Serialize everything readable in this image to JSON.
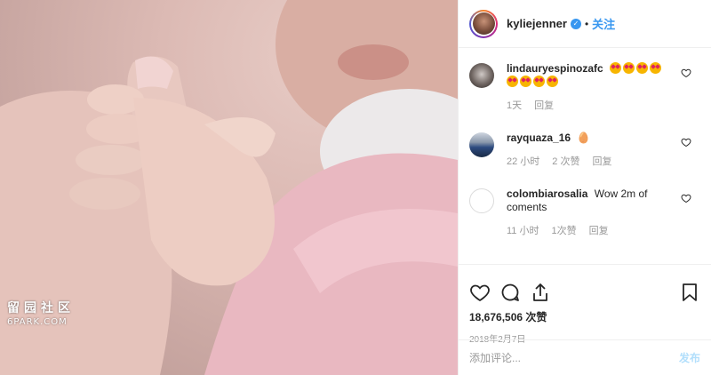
{
  "post": {
    "photo_alt": "baby hand holding finger photo",
    "watermark": {
      "cn": "留园社区",
      "en": "6PARK.COM"
    }
  },
  "header": {
    "username": "kyliejenner",
    "verified_icon": "verified-badge-icon",
    "separator": "•",
    "follow_label": "关注"
  },
  "comments": [
    {
      "username": "lindauryespinozafc",
      "text": "",
      "emoji_count": 8,
      "time": "1天",
      "likes": "",
      "reply_label": "回复"
    },
    {
      "username": "rayquaza_16",
      "text": "🥚",
      "time": "22 小时",
      "likes": "2 次赞",
      "reply_label": "回复"
    },
    {
      "username": "colombiarosalia",
      "text": "Wow 2m of coments",
      "time": "11 小时",
      "likes": "1次赞",
      "reply_label": "回复"
    }
  ],
  "actions": {
    "like_icon": "heart-outline-icon",
    "comment_icon": "comment-bubble-icon",
    "share_icon": "share-upload-icon",
    "save_icon": "bookmark-icon"
  },
  "likes_text": "18,676,506 次赞",
  "date_text": "2018年2月7日",
  "add_comment": {
    "placeholder": "添加评论...",
    "post_label": "发布"
  },
  "colors": {
    "accent": "#3897f0",
    "post_disabled": "#b2dffc",
    "muted": "#999999",
    "text": "#262626"
  }
}
